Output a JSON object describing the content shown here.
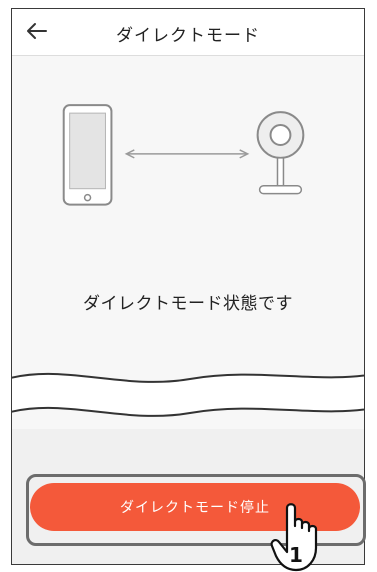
{
  "header": {
    "title": "ダイレクトモード",
    "back_icon": "back-arrow-icon"
  },
  "illustration": {
    "left_device": "smartphone-icon",
    "connector": "double-arrow-icon",
    "right_device": "camera-icon"
  },
  "main": {
    "status_text": "ダイレクトモード状態です"
  },
  "footer": {
    "stop_button_label": "ダイレクトモード停止",
    "step_number": "1"
  },
  "colors": {
    "accent": "#f4593a",
    "background": "#f7f7f7"
  }
}
